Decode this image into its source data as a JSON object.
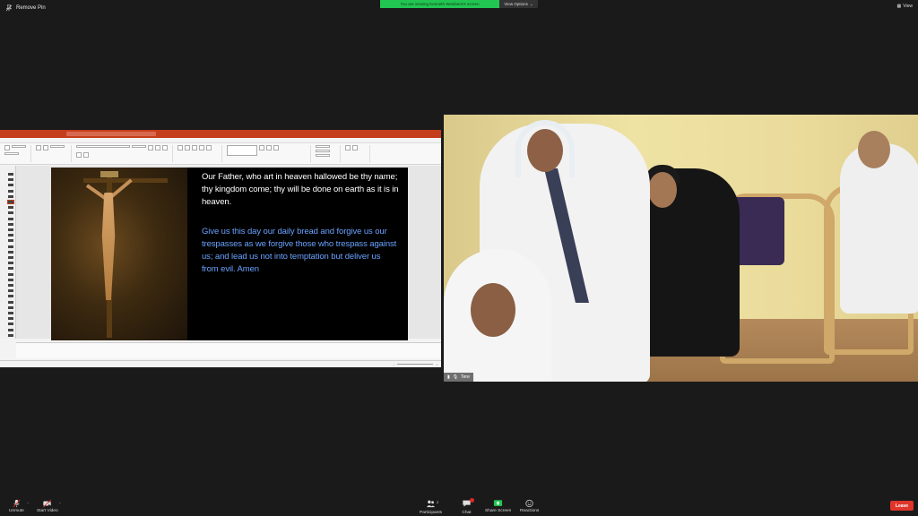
{
  "top": {
    "remove_pin_label": "Remove Pin",
    "share_banner": "You are viewing Kenneth Weisbeck's screen",
    "view_options": "View Options",
    "view_button": "View"
  },
  "powerpoint": {
    "slide": {
      "prayer_part1": "Our Father, who art in heaven hallowed be thy name; thy kingdom come; thy will be done on earth as it is in heaven.",
      "prayer_part2": "Give us this day our daily bread and forgive us our trespasses as we forgive those who trespass against us; and lead us not into temptation but deliver us from evil. Amen"
    }
  },
  "video": {
    "participant_name": "Tere"
  },
  "toolbar": {
    "unmute": "Unmute",
    "start_video": "Start Video",
    "participants": "Participants",
    "participants_count": "2",
    "chat": "Chat",
    "share_screen": "Share Screen",
    "reactions": "Reactions",
    "leave": "Leave"
  },
  "colors": {
    "share_banner": "#23c552",
    "ppt_accent": "#c43e1c",
    "leave": "#e0352b",
    "verse_blue": "#6aa3ff"
  }
}
